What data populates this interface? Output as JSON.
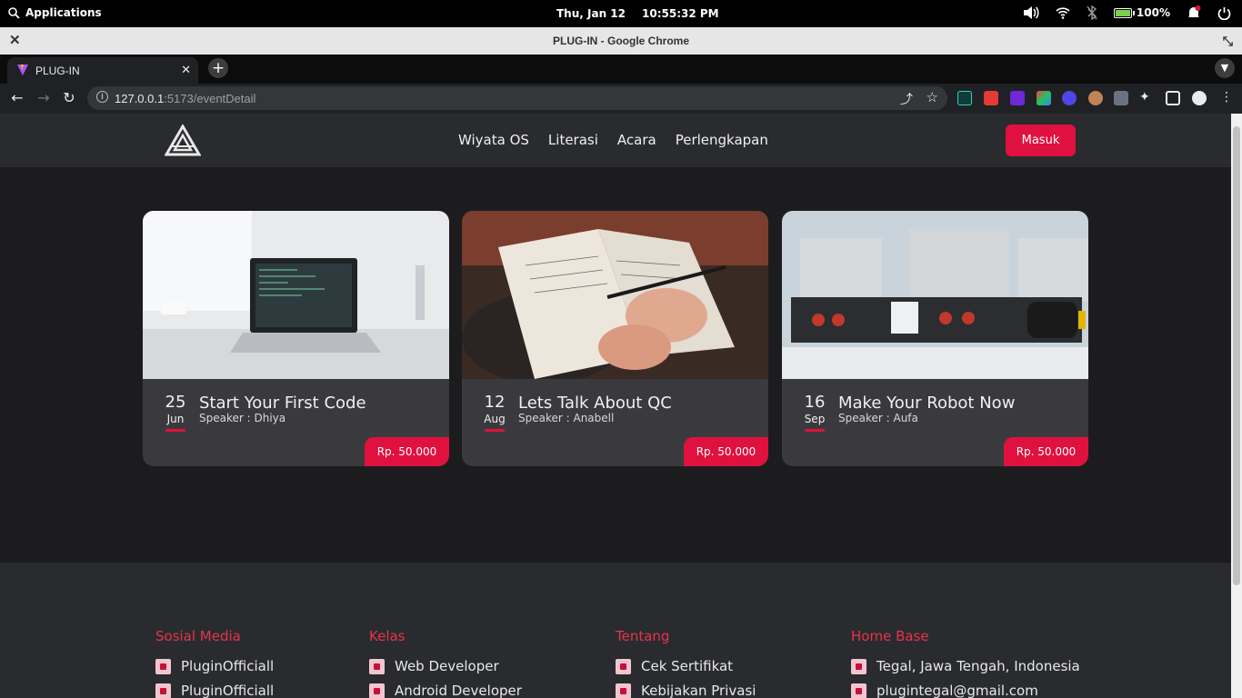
{
  "topbar": {
    "apps_label": "Applications",
    "date": "Thu, Jan 12",
    "time": "10:55:32 PM",
    "battery": "100%"
  },
  "window": {
    "title": "PLUG-IN - Google Chrome"
  },
  "tab": {
    "title": "PLUG-IN"
  },
  "omnibox": {
    "host": "127.0.0.1",
    "path": ":5173/eventDetail"
  },
  "nav": {
    "links": [
      "Wiyata OS",
      "Literasi",
      "Acara",
      "Perlengkapan"
    ],
    "login_label": "Masuk"
  },
  "events": [
    {
      "day": "25",
      "month": "Jun",
      "title": "Start Your First Code",
      "speaker": "Speaker : Dhiya",
      "price": "Rp. 50.000",
      "image": "laptop-on-desk"
    },
    {
      "day": "12",
      "month": "Aug",
      "title": "Lets Talk About QC",
      "speaker": "Speaker : Anabell",
      "price": "Rp. 50.000",
      "image": "hand-writing-notebook"
    },
    {
      "day": "16",
      "month": "Sep",
      "title": "Make Your Robot Now",
      "speaker": "Speaker : Aufa",
      "price": "Rp. 50.000",
      "image": "lego-robots"
    }
  ],
  "footer": {
    "social": {
      "heading": "Sosial Media",
      "items": [
        "PluginOfficiall",
        "PluginOfficiall"
      ]
    },
    "kelas": {
      "heading": "Kelas",
      "items": [
        "Web Developer",
        "Android Developer"
      ]
    },
    "tentang": {
      "heading": "Tentang",
      "items": [
        "Cek Sertifikat",
        "Kebijakan Privasi"
      ]
    },
    "home": {
      "heading": "Home Base",
      "items": [
        "Tegal, Jawa Tengah, Indonesia",
        "plugintegal@gmail.com"
      ]
    }
  },
  "colors": {
    "accent": "#e0113f",
    "page_bg": "#1c1c1f",
    "nav_bg": "#2a2b2e",
    "card_bg": "#3a3a3e"
  }
}
